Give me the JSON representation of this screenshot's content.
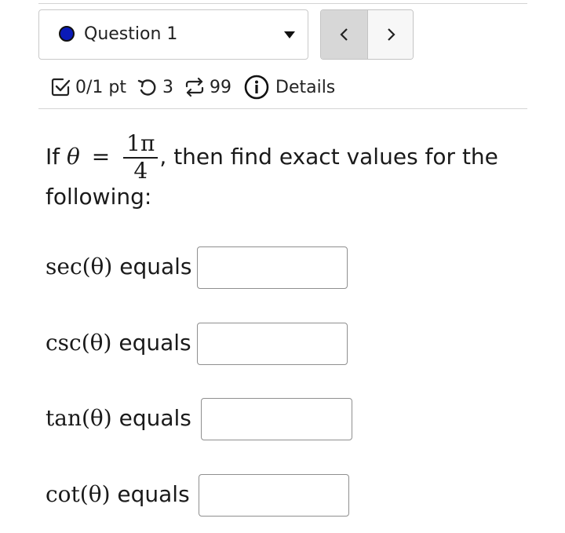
{
  "question": {
    "label": "Question 1",
    "status_color": "#0a1ab8"
  },
  "pager": {
    "prev_icon": "chevron-left-icon",
    "next_icon": "chevron-right-icon"
  },
  "meta": {
    "score": "0/1 pt",
    "attempts": "3",
    "versions": "99",
    "details": "Details"
  },
  "problem": {
    "prefix": "If",
    "variable": "θ",
    "equals": "=",
    "numerator": "1π",
    "denominator": "4",
    "text": ", then find exact values for the following:"
  },
  "rows": [
    {
      "func": "sec(θ)",
      "label": "equals",
      "value": ""
    },
    {
      "func": "csc(θ)",
      "label": "equals",
      "value": ""
    },
    {
      "func": "tan(θ)",
      "label": "equals",
      "value": ""
    },
    {
      "func": "cot(θ)",
      "label": "equals",
      "value": ""
    }
  ]
}
